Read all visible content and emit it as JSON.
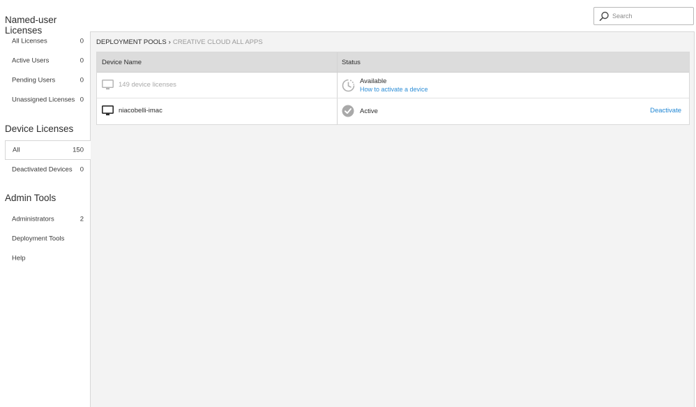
{
  "sidebar": {
    "named_user": {
      "title": "Named-user Licenses",
      "items": [
        {
          "label": "All Licenses",
          "count": "0"
        },
        {
          "label": "Active Users",
          "count": "0"
        },
        {
          "label": "Pending Users",
          "count": "0"
        },
        {
          "label": "Unassigned Licenses",
          "count": "0"
        }
      ]
    },
    "device": {
      "title": "Device Licenses",
      "items": [
        {
          "label": "All",
          "count": "150",
          "selected": true
        },
        {
          "label": "Deactivated Devices",
          "count": "0"
        }
      ]
    },
    "admin": {
      "title": "Admin Tools",
      "items": [
        {
          "label": "Administrators",
          "count": "2"
        },
        {
          "label": "Deployment Tools",
          "count": ""
        },
        {
          "label": "Help",
          "count": ""
        }
      ]
    }
  },
  "search": {
    "placeholder": "Search",
    "value": ""
  },
  "breadcrumb": {
    "root": "DEPLOYMENT POOLS",
    "separator": "›",
    "current": "CREATIVE CLOUD ALL APPS"
  },
  "table": {
    "columns": [
      "Device Name",
      "Status"
    ],
    "rows": [
      {
        "device_name": "149 device licenses",
        "device_icon": "monitor-icon",
        "status": "Available",
        "status_icon": "pending-clock-icon",
        "status_link": "How to activate a device",
        "action": ""
      },
      {
        "device_name": "niacobelli-imac",
        "device_icon": "monitor-icon",
        "status": "Active",
        "status_icon": "checkmark-circle-icon",
        "status_link": "",
        "action": "Deactivate"
      }
    ]
  },
  "colors": {
    "link": "#2d8ed7",
    "panel_bg": "#f3f3f3",
    "header_bg": "#dcdcdc",
    "muted": "#a8a8a8"
  }
}
